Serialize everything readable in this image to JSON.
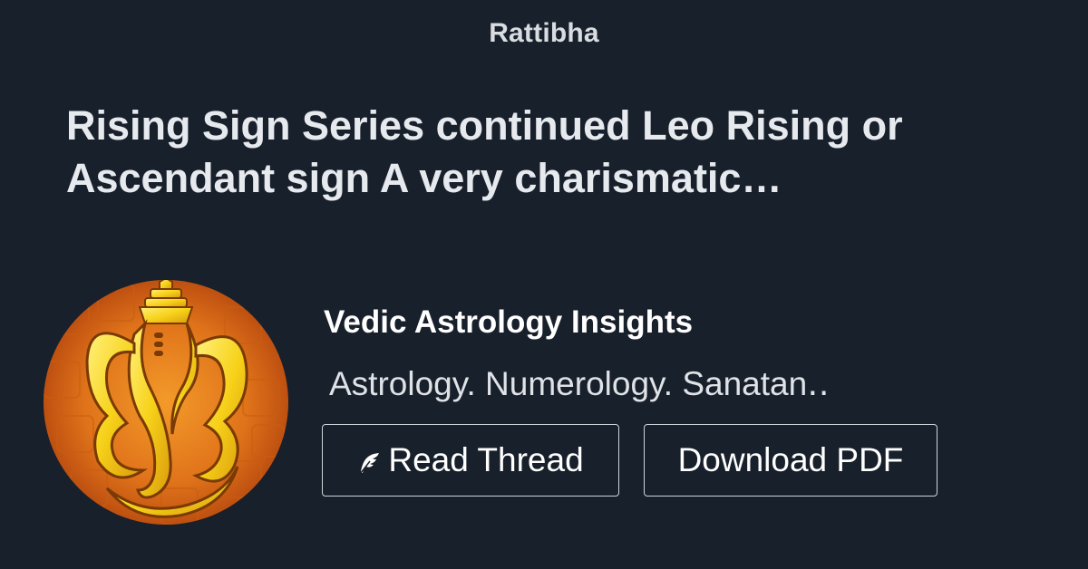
{
  "brand": {
    "name": "Rattibha"
  },
  "thread": {
    "title": "Rising Sign Series continued Leo Rising or Ascendant sign A very charismatic…"
  },
  "author": {
    "name": "Vedic Astrology Insights",
    "bio": "Astrology. Numerology. Sanatan‥",
    "avatar_icon": "ganesha-logo-icon"
  },
  "actions": {
    "read_label": "Read Thread",
    "read_icon": "feather-icon",
    "pdf_label": "Download PDF"
  },
  "colors": {
    "background": "#18202b",
    "text": "#e6e9ee",
    "avatar_orange": "#e8731a",
    "avatar_gold": "#f7d21a"
  }
}
